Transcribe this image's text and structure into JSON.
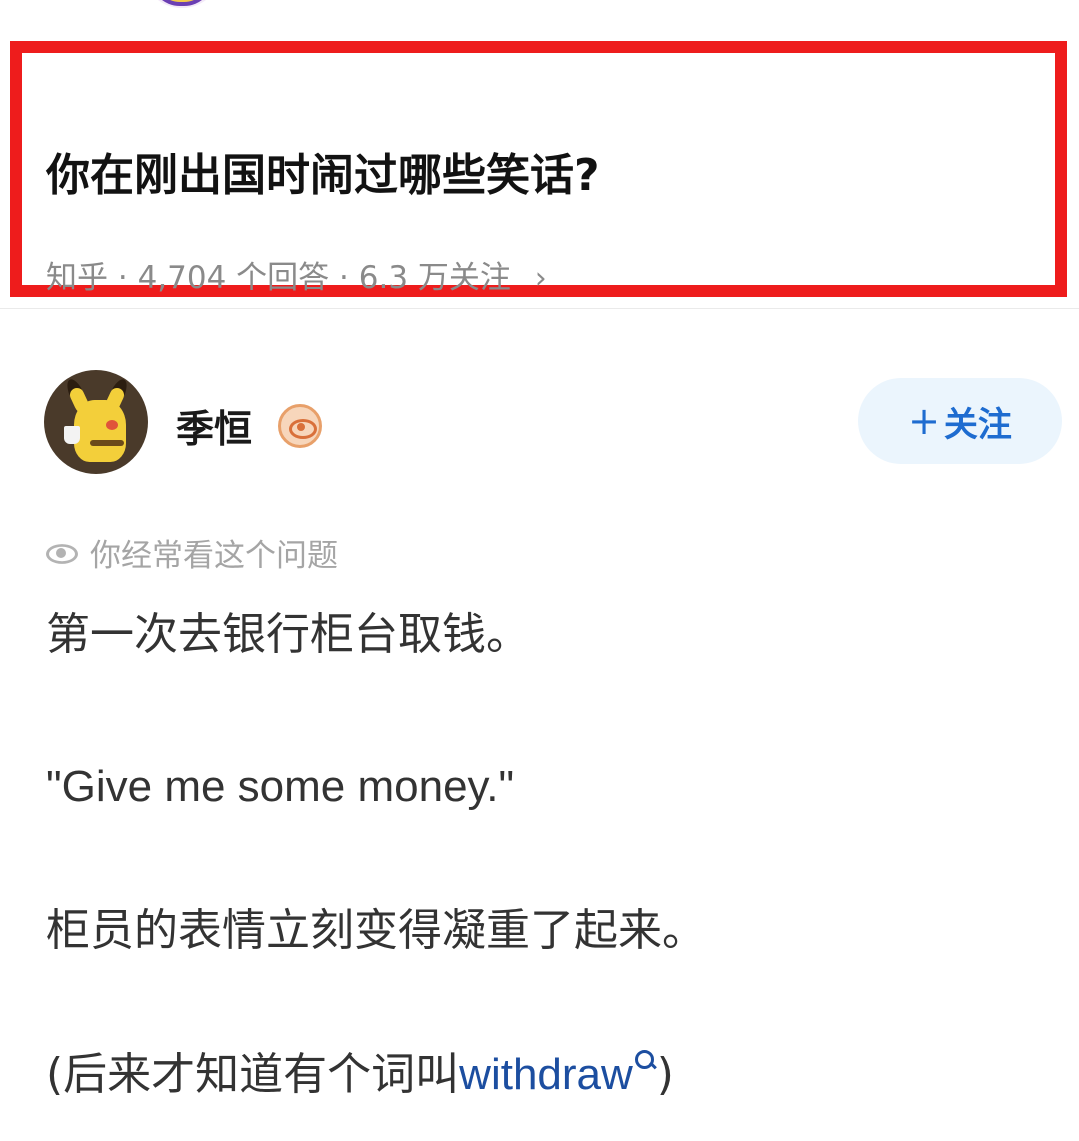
{
  "question": {
    "title": "你在刚出国时闹过哪些笑话?",
    "source": "知乎",
    "answers_count": "4,704 个回答",
    "followers": "6.3 万关注",
    "chevron": "›"
  },
  "answer": {
    "author_name": "季恒",
    "badge_icon": "eye-badge-icon",
    "follow_label": "关注",
    "follow_plus": "+",
    "visit_note": "你经常看这个问题",
    "paragraphs": [
      "第一次去银行柜台取钱。",
      "\"Give me some money.\"",
      "柜员的表情立刻变得凝重了起来。"
    ],
    "last_paragraph": {
      "prefix": "(后来才知道有个词叫",
      "link": "withdraw",
      "suffix": ")"
    }
  },
  "colors": {
    "highlight_border": "#ee1c1c",
    "link": "#1c4ea0",
    "follow_text": "#1e6cd0",
    "follow_bg": "#ebf5fd"
  }
}
